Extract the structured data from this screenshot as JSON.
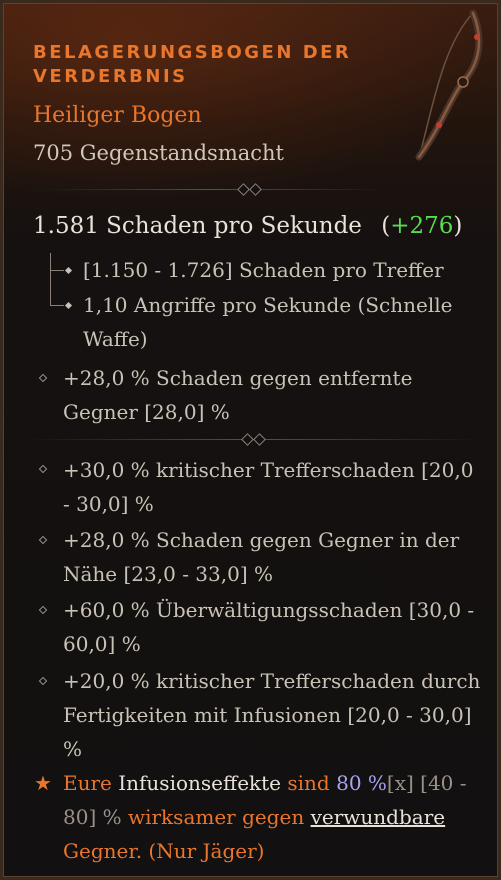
{
  "item": {
    "name": "BELAGERUNGSBOGEN DER VERDERBNIS",
    "type": "Heiliger Bogen",
    "power": "705 Gegenstandsmacht"
  },
  "weapon": {
    "dps": "1.581 Schaden pro Sekunde",
    "dps_delta_open": "(",
    "dps_delta": "+276",
    "dps_delta_close": ")",
    "damage_per_hit": "[1.150 - 1.726] Schaden pro Treffer",
    "attacks_per_second": "1,10 Angriffe pro Sekunde (Schnelle Waffe)"
  },
  "implicit": "+28,0 % Schaden gegen entfernte Gegner [28,0] %",
  "affixes": [
    "+30,0 % kritischer Trefferschaden [20,0 - 30,0] %",
    "+28,0 % Schaden gegen Gegner in der Nähe [23,0 - 33,0] %",
    "+60,0 % Überwältigungsschaden [30,0 - 60,0] %",
    "+20,0 % kritischer Trefferschaden durch Fertigkeiten mit Infusionen [20,0 - 30,0] %"
  ],
  "legendary": {
    "p1": "Eure ",
    "p2": "Infusionseffekte",
    "p3": " sind ",
    "p4": "80 %",
    "p5": "[x]",
    "p6": " [40 - 80] % ",
    "p7": "wirksamer gegen ",
    "p8": "verwundbare",
    "p9": " Gegner. (Nur Jäger)"
  },
  "colors": {
    "legendary_orange": "#e8762c",
    "stat_green": "#5adc50",
    "roll_purple": "#a8a2f0",
    "text": "#c9c2b6"
  },
  "icons": {
    "item": "bow-icon",
    "legendary_marker": "star-icon",
    "affix_marker": "diamond-bullet-icon"
  }
}
